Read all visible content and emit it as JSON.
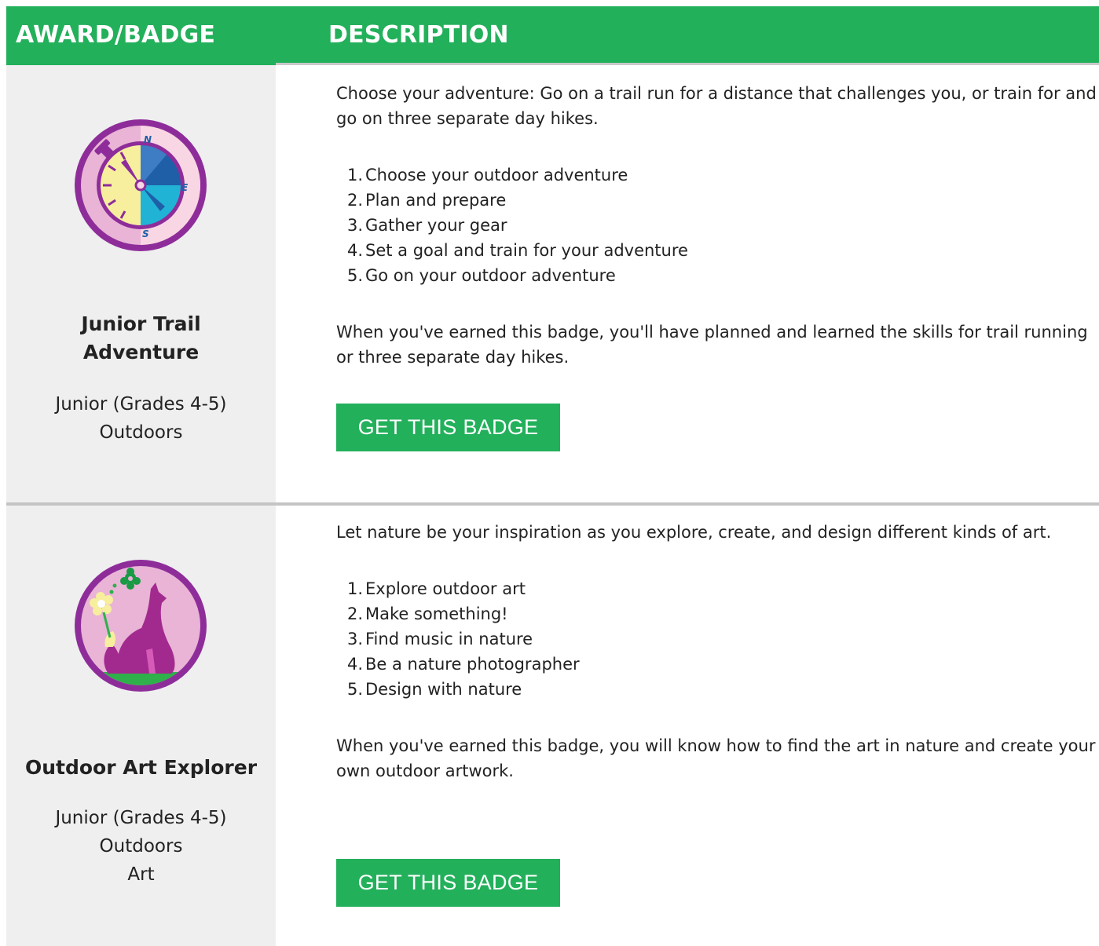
{
  "header": {
    "award_label": "AWARD/BADGE",
    "description_label": "DESCRIPTION"
  },
  "colors": {
    "brand_green": "#23b05b",
    "left_panel_bg": "#efefef",
    "badge_ring": "#8e2d9a"
  },
  "badges": [
    {
      "icon": "compass-badge-icon",
      "title_line1": "Junior Trail",
      "title_line2": "Adventure",
      "level": "Junior (Grades 4-5)",
      "category": "Outdoors",
      "category2": "",
      "intro": "Choose your adventure: Go on a trail run for a distance that challenges you, or train for and go on three separate day hikes.",
      "steps": [
        {
          "num": "1.",
          "text": "Choose your outdoor adventure"
        },
        {
          "num": "2.",
          "text": "Plan and prepare"
        },
        {
          "num": "3.",
          "text": "Gather your gear"
        },
        {
          "num": "4.",
          "text": "Set a goal and train for your adventure"
        },
        {
          "num": "5.",
          "text": "Go on your outdoor adventure"
        }
      ],
      "outcome": "When you've earned this badge, you'll have planned and learned the skills for trail running or three separate day hikes.",
      "button_label": "GET THIS BADGE",
      "compass_letters": {
        "n": "N",
        "e": "E",
        "s": "S"
      }
    },
    {
      "icon": "fox-flower-badge-icon",
      "title_line1": "Outdoor Art Explorer",
      "title_line2": "",
      "level": "Junior (Grades 4-5)",
      "category": "Outdoors",
      "category2": "Art",
      "intro": "Let nature be your inspiration as you explore, create, and design different kinds of art.",
      "steps": [
        {
          "num": "1.",
          "text": "Explore outdoor art"
        },
        {
          "num": "2.",
          "text": "Make something!"
        },
        {
          "num": "3.",
          "text": "Find music in nature"
        },
        {
          "num": "4.",
          "text": "Be a nature photographer"
        },
        {
          "num": "5.",
          "text": "Design with nature"
        }
      ],
      "outcome": "When you've earned this badge, you will know how to find the art in nature and create your own outdoor artwork.",
      "button_label": "GET THIS BADGE"
    }
  ]
}
